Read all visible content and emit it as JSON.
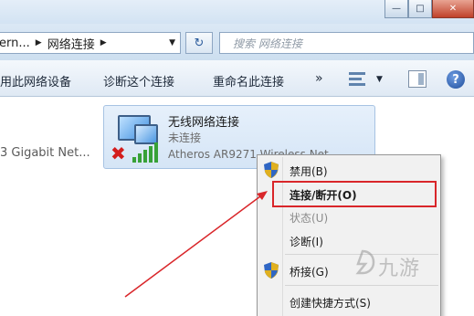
{
  "window": {
    "minimize": "—",
    "maximize": "□",
    "close": "✕"
  },
  "address": {
    "crumb_parent": "ern...",
    "crumb_current": "网络连接",
    "refresh_glyph": "↻",
    "search_placeholder": "搜索 网络连接"
  },
  "toolbar": {
    "disable_device": "用此网络设备",
    "diagnose": "诊断这个连接",
    "rename": "重命名此连接",
    "more": "»",
    "help": "?"
  },
  "content": {
    "other_adapter": "3 Gigabit Net...",
    "connection": {
      "name": "无线网络连接",
      "status": "未连接",
      "device": "Atheros AR9271 Wireless Net..."
    }
  },
  "context_menu": {
    "items": [
      {
        "label": "禁用(B)"
      },
      {
        "label": "连接/断开(O)"
      },
      {
        "label": "状态(U)"
      },
      {
        "label": "诊断(I)"
      },
      {
        "label": "桥接(G)"
      },
      {
        "label": "创建快捷方式(S)"
      }
    ]
  },
  "watermark": {
    "text": "九游"
  },
  "colors": {
    "highlight_border": "#d9262a",
    "arrow": "#d9262a",
    "card_bg": "#dce9f7"
  }
}
